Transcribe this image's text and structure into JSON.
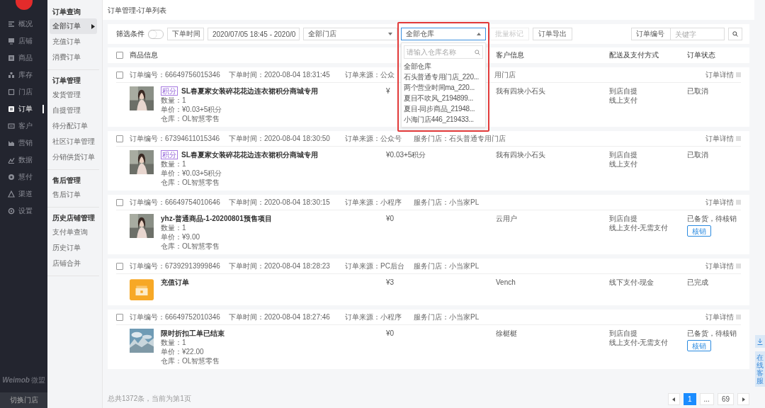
{
  "sidebar": {
    "items": [
      {
        "label": "概况",
        "selected": false
      },
      {
        "label": "店铺",
        "selected": false
      },
      {
        "label": "商品",
        "selected": false
      },
      {
        "label": "库存",
        "selected": false
      },
      {
        "label": "门店",
        "selected": false
      },
      {
        "label": "订单",
        "selected": true
      },
      {
        "label": "客户",
        "selected": false
      },
      {
        "label": "营销",
        "selected": false
      },
      {
        "label": "数据",
        "selected": false
      },
      {
        "label": "慧付",
        "selected": false
      },
      {
        "label": "渠道",
        "selected": false
      },
      {
        "label": "设置",
        "selected": false
      }
    ],
    "brand": "Weimob",
    "brand_cn": "微盟",
    "switch_button": "切换门店"
  },
  "submenu": {
    "groups": [
      {
        "title": "订单查询",
        "items": [
          {
            "label": "全部订单",
            "selected": true
          },
          {
            "label": "充值订单",
            "selected": false
          },
          {
            "label": "消费订单",
            "selected": false
          }
        ]
      },
      {
        "title": "订单管理",
        "items": [
          {
            "label": "发货管理",
            "selected": false
          },
          {
            "label": "自提管理",
            "selected": false
          },
          {
            "label": "待分配订单",
            "selected": false
          },
          {
            "label": "社区订单管理",
            "selected": false
          },
          {
            "label": "分销供货订单",
            "selected": false
          }
        ]
      },
      {
        "title": "售后管理",
        "items": [
          {
            "label": "售后订单",
            "selected": false
          }
        ]
      },
      {
        "title": "历史店铺管理",
        "items": [
          {
            "label": "支付单查询",
            "selected": false
          },
          {
            "label": "历史订单",
            "selected": false
          },
          {
            "label": "店铺合并",
            "selected": false
          }
        ]
      }
    ]
  },
  "breadcrumb": "订单管理-订单列表",
  "filters": {
    "label": "筛选条件",
    "toggle_on": false,
    "time_select": "下单时间",
    "date_range": "2020/07/05 18:45 - 2020/0",
    "store_select": "全部门店",
    "warehouse_select": "全部仓库",
    "warehouse_menu": {
      "placeholder": "请输入仓库名称",
      "options": [
        "全部仓库",
        "石头普通专用门店_220...",
        "两个营业时间ma_220...",
        "夏目不吹风_2194899...",
        "夏目-同步商品_21948...",
        "小海门店446_219433..."
      ]
    },
    "batch_button": "批量标记",
    "batch_disabled": true,
    "export_button": "订单导出",
    "search_select": "订单编号",
    "search_placeholder": "关键字"
  },
  "table": {
    "select_all_checked": false,
    "columns": [
      "商品信息",
      "",
      "客户信息",
      "配送及支付方式",
      "订单状态"
    ]
  },
  "orders": [
    {
      "checked": false,
      "number": "订单编号：66649756015346",
      "time": "下单时间：2020-08-04 18:31:45",
      "source": "订单来源：公众",
      "store": "用门店",
      "store_partial": true,
      "detail": "订单详情",
      "kind": "product",
      "tag": "积分",
      "name": "SL春夏家女装碎花花边连衣裙积分商城专用",
      "lines": [
        "数量：1",
        "单价：¥0.03+5积分",
        "仓库：OL智慧零售"
      ],
      "amount": "¥",
      "customer": "我有四块小石头",
      "delivery": [
        "到店自提",
        "线上支付"
      ],
      "status": "已取消"
    },
    {
      "checked": false,
      "number": "订单编号：67394611015346",
      "time": "下单时间：2020-08-04 18:30:50",
      "source": "订单来源：公众号",
      "store": "服务门店：石头普通专用门店",
      "detail": "订单详情",
      "kind": "product",
      "tag": "积分",
      "name": "SL春夏家女装碎花花边连衣裙积分商城专用",
      "lines": [
        "数量：1",
        "单价：¥0.03+5积分",
        "仓库：OL智慧零售"
      ],
      "amount": "¥0.03+5积分",
      "customer": "我有四块小石头",
      "delivery": [
        "到店自提",
        "线上支付"
      ],
      "status": "已取消"
    },
    {
      "checked": false,
      "number": "订单编号：66649754010646",
      "time": "下单时间：2020-08-04 18:30:15",
      "source": "订单来源：小程序",
      "store": "服务门店：小当家PL",
      "detail": "订单详情",
      "kind": "product",
      "name": "yhz-普通商品-1-20200801预售项目",
      "lines": [
        "数量：1",
        "单价：¥9.00",
        "仓库：OL智慧零售"
      ],
      "amount": "¥0",
      "customer": "云用户",
      "delivery": [
        "到店自提",
        "线上支付-无需支付"
      ],
      "status": "已备货，待核销",
      "action": "核销"
    },
    {
      "checked": false,
      "number": "订单编号：67392913999846",
      "time": "下单时间：2020-08-04 18:28:23",
      "source": "订单来源：PC后台",
      "store": "服务门店：小当家PL",
      "detail": "订单详情",
      "kind": "recharge",
      "name": "充值订单",
      "amount": "¥3",
      "customer": "Vench",
      "delivery": [
        "线下支付-现金"
      ],
      "status": "已完成"
    },
    {
      "checked": false,
      "number": "订单编号：66649752010346",
      "time": "下单时间：2020-08-04 18:27:46",
      "source": "订单来源：小程序",
      "store": "服务门店：小当家PL",
      "detail": "订单详情",
      "kind": "landscape",
      "name": "限时折扣工单已结束",
      "lines": [
        "数量：1",
        "单价：¥22.00",
        "仓库：OL智慧零售"
      ],
      "amount": "¥0",
      "customer": "徐梃梃",
      "delivery": [
        "到店自提",
        "线上支付-无需支付"
      ],
      "status": "已备货，待核销",
      "action": "核销"
    }
  ],
  "pager": {
    "summary": "总共1372条，当前为第1页",
    "pages": [
      {
        "label": "1",
        "selected": true
      },
      {
        "label": "...",
        "selected": false
      },
      {
        "label": "69",
        "selected": false
      }
    ]
  },
  "float_service": "在线客服"
}
